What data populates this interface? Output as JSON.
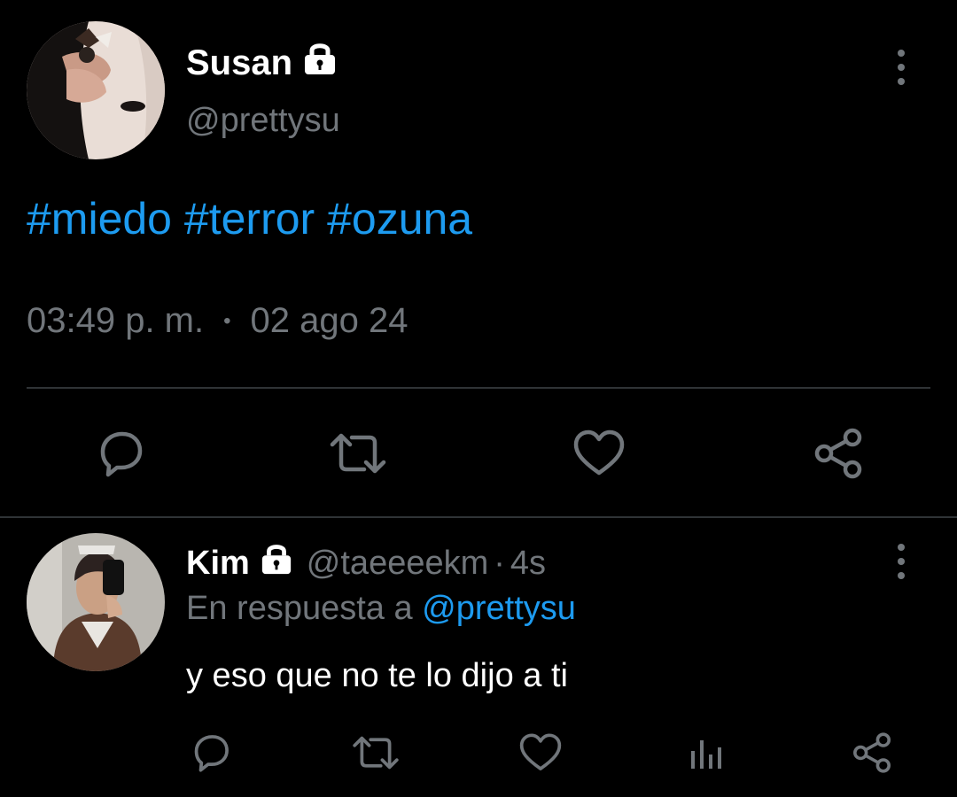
{
  "main_tweet": {
    "author": {
      "name": "Susan",
      "handle": "@prettysu",
      "protected_icon": "lock-icon"
    },
    "hashtags": [
      "#miedo",
      "#terror",
      "#ozuna"
    ],
    "time": "03:49 p. m.",
    "separator": "•",
    "date": "02 ago 24",
    "actions": [
      "reply-icon",
      "retweet-icon",
      "like-icon",
      "share-icon"
    ]
  },
  "reply": {
    "author": {
      "name": "Kim",
      "handle": "@taeeeekm",
      "protected_icon": "lock-icon"
    },
    "dot": "·",
    "time_ago": "4s",
    "in_reply_to_label": "En respuesta a",
    "in_reply_to_handle": "@prettysu",
    "text": "y eso que no te lo dijo a ti",
    "actions": [
      "reply-icon",
      "retweet-icon",
      "like-icon",
      "analytics-icon",
      "share-icon"
    ]
  },
  "colors": {
    "background": "#000000",
    "text_primary": "#ffffff",
    "text_secondary": "#71767b",
    "accent": "#1d9bf0",
    "divider": "#2f3336"
  }
}
